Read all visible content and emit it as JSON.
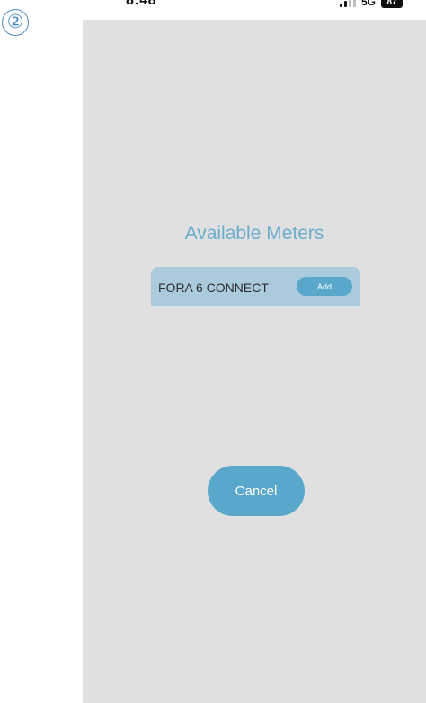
{
  "annotation": {
    "step_marker": "②"
  },
  "status_bar": {
    "time": "8:48",
    "network": "5G",
    "battery": "87"
  },
  "main": {
    "title": "Available Meters",
    "meters": [
      {
        "name": "FORA 6 CONNECT",
        "add_label": "Add"
      }
    ],
    "cancel_label": "Cancel"
  },
  "colors": {
    "screen_background": "#e0e0e0",
    "accent": "#5aa7cc",
    "title": "#6aaccc",
    "meter_row": "#a9cbdc"
  },
  "icons": {
    "signal": "signal-icon",
    "battery": "battery-icon"
  }
}
